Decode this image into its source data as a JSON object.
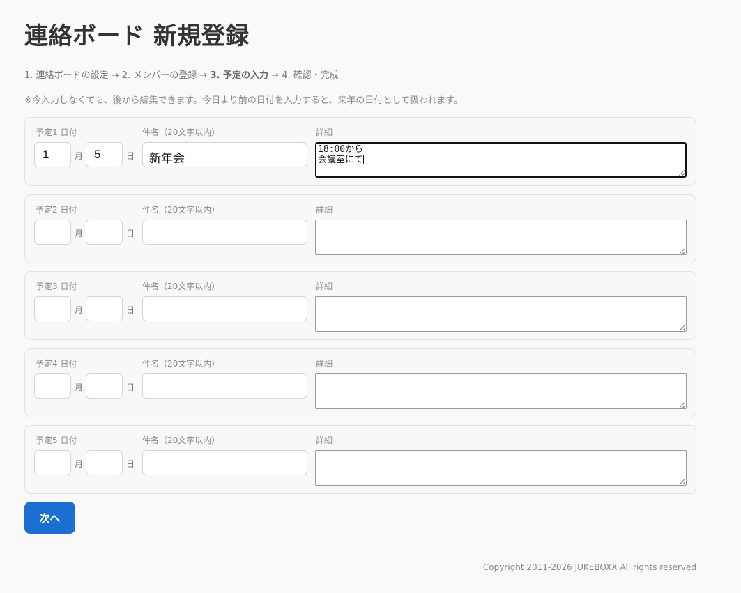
{
  "page": {
    "title": "連絡ボード 新規登録"
  },
  "steps": {
    "step1": "1. 連絡ボードの設定",
    "arrow": "→",
    "step2": "2. メンバーの登録",
    "step3": "3. 予定の入力",
    "step4": "4. 確認・完成",
    "current_step": 3
  },
  "note": "※今入力しなくても、後から編集できます。今日より前の日付を入力すると、来年の日付として扱われます。",
  "labels": {
    "month_unit": "月",
    "day_unit": "日",
    "title_field": "件名（20文字以内）",
    "detail_field": "詳細"
  },
  "entries": [
    {
      "date_label": "予定1 日付",
      "month": "1",
      "day": "5",
      "title": "新年会",
      "detail_lines": [
        "18:00から",
        "会議室にて"
      ],
      "focused": true
    },
    {
      "date_label": "予定2 日付",
      "month": "",
      "day": "",
      "title": "",
      "detail_lines": [
        "",
        ""
      ],
      "focused": false
    },
    {
      "date_label": "予定3 日付",
      "month": "",
      "day": "",
      "title": "",
      "detail_lines": [
        "",
        ""
      ],
      "focused": false
    },
    {
      "date_label": "予定4 日付",
      "month": "",
      "day": "",
      "title": "",
      "detail_lines": [
        "",
        ""
      ],
      "focused": false
    },
    {
      "date_label": "予定5 日付",
      "month": "",
      "day": "",
      "title": "",
      "detail_lines": [
        "",
        ""
      ],
      "focused": false
    }
  ],
  "buttons": {
    "next": "次へ"
  },
  "footer": {
    "copyright": "Copyright 2011-2026 JUKEBOXX All rights reserved"
  },
  "colors": {
    "primary": "#1a6fd1",
    "background": "#f9f9f9"
  }
}
